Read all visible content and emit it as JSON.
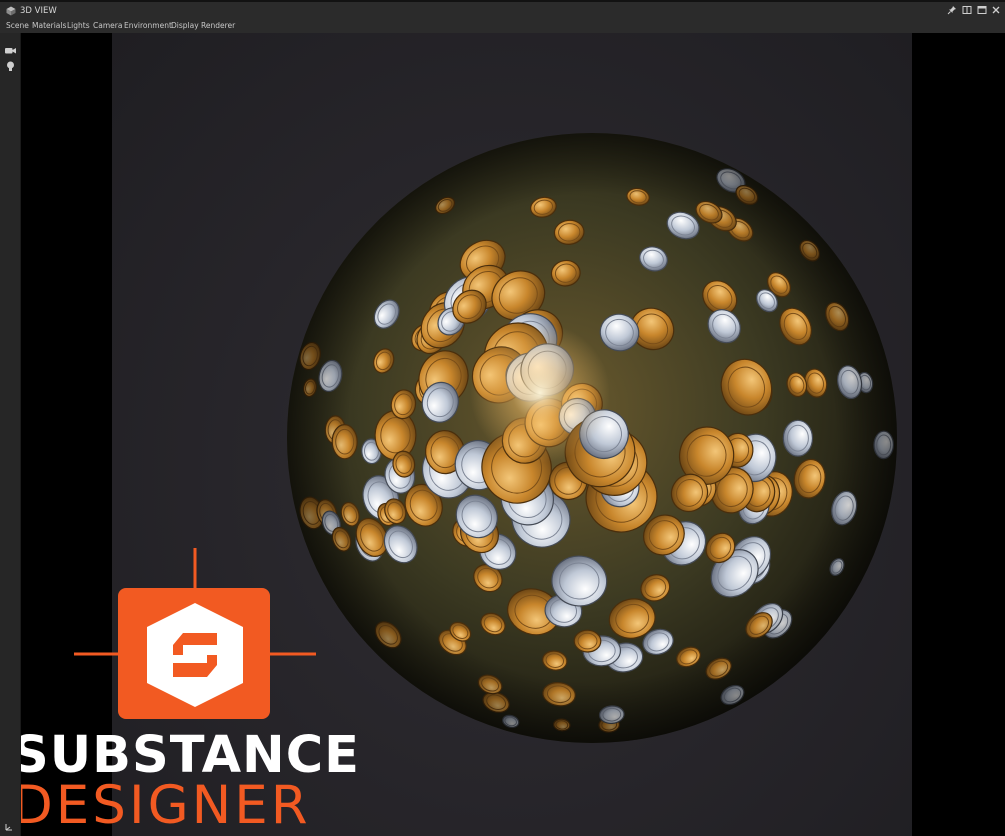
{
  "window": {
    "title": "3D VIEW",
    "controls": [
      {
        "name": "pin",
        "icon": "pin-icon"
      },
      {
        "name": "split",
        "icon": "split-view-icon"
      },
      {
        "name": "maximize",
        "icon": "maximize-icon"
      },
      {
        "name": "close",
        "icon": "close-icon"
      }
    ]
  },
  "menu": {
    "items": [
      "Scene",
      "Materials",
      "Lights",
      "Camera",
      "Environment",
      "Display",
      "Renderer"
    ]
  },
  "toolbar": {
    "buttons": [
      {
        "name": "camera",
        "icon": "video-camera-icon"
      },
      {
        "name": "light",
        "icon": "lightbulb-icon"
      }
    ]
  },
  "logo": {
    "line1": "SUBSTANCE",
    "line2": "DESIGNER",
    "accent_color": "#f25a22"
  },
  "colors": {
    "panel": "#2b2b2b",
    "background": "#000000",
    "viewport_bg": "#28262b",
    "gold": "#c8862c",
    "silver": "#c9d0db"
  }
}
